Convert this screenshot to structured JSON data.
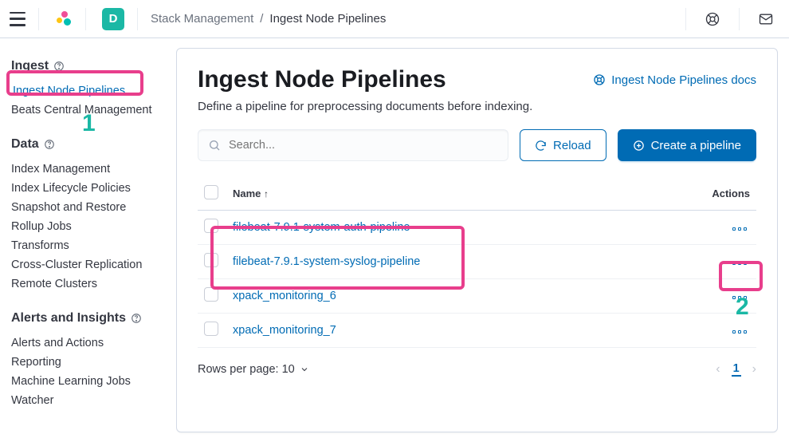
{
  "topbar": {
    "avatar_letter": "D",
    "breadcrumb_parent": "Stack Management",
    "breadcrumb_sep": "/",
    "breadcrumb_current": "Ingest Node Pipelines"
  },
  "sidebar": {
    "groups": [
      {
        "heading": "Ingest",
        "items": [
          {
            "label": "Ingest Node Pipelines",
            "active": true
          },
          {
            "label": "Beats Central Management",
            "active": false
          }
        ]
      },
      {
        "heading": "Data",
        "items": [
          {
            "label": "Index Management"
          },
          {
            "label": "Index Lifecycle Policies"
          },
          {
            "label": "Snapshot and Restore"
          },
          {
            "label": "Rollup Jobs"
          },
          {
            "label": "Transforms"
          },
          {
            "label": "Cross-Cluster Replication"
          },
          {
            "label": "Remote Clusters"
          }
        ]
      },
      {
        "heading": "Alerts and Insights",
        "items": [
          {
            "label": "Alerts and Actions"
          },
          {
            "label": "Reporting"
          },
          {
            "label": "Machine Learning Jobs"
          },
          {
            "label": "Watcher"
          }
        ]
      }
    ]
  },
  "main": {
    "title": "Ingest Node Pipelines",
    "docs_link": "Ingest Node Pipelines docs",
    "subtitle": "Define a pipeline for preprocessing documents before indexing.",
    "search_placeholder": "Search...",
    "reload_label": "Reload",
    "create_label": "Create a pipeline",
    "columns": {
      "name": "Name",
      "actions": "Actions"
    },
    "rows": [
      {
        "name": "filebeat-7.9.1-system-auth-pipeline"
      },
      {
        "name": "filebeat-7.9.1-system-syslog-pipeline"
      },
      {
        "name": "xpack_monitoring_6"
      },
      {
        "name": "xpack_monitoring_7"
      }
    ],
    "rows_per_page_label": "Rows per page: 10",
    "current_page": "1"
  },
  "annotations": {
    "num1": "1",
    "num2": "2"
  }
}
